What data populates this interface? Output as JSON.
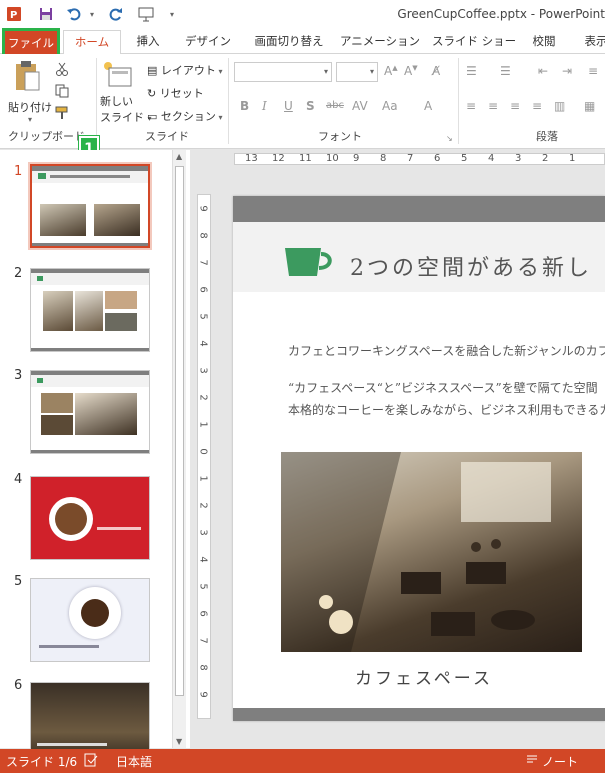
{
  "titlebar": {
    "app_icon": "powerpoint-icon",
    "title": "GreenCupCoffee.pptx - PowerPoint"
  },
  "tabs": [
    {
      "label": "ファイル"
    },
    {
      "label": "ホーム"
    },
    {
      "label": "挿入"
    },
    {
      "label": "デザイン"
    },
    {
      "label": "画面切り替え"
    },
    {
      "label": "アニメーション"
    },
    {
      "label": "スライド ショー"
    },
    {
      "label": "校閲"
    },
    {
      "label": "表示"
    }
  ],
  "ribbon": {
    "clipboard": {
      "paste": "貼り付け",
      "group": "クリップボード"
    },
    "slides": {
      "new_slide_line1": "新しい",
      "new_slide_line2": "スライド",
      "layout": "レイアウト",
      "reset": "リセット",
      "section": "セクション",
      "group": "スライド"
    },
    "font": {
      "group": "フォント"
    },
    "paragraph": {
      "group": "段落"
    }
  },
  "callout": {
    "badge": "1"
  },
  "thumbnails": [
    {
      "number": "1",
      "selected": true
    },
    {
      "number": "2",
      "selected": false
    },
    {
      "number": "3",
      "selected": false
    },
    {
      "number": "4",
      "selected": false
    },
    {
      "number": "5",
      "selected": false
    },
    {
      "number": "6",
      "selected": false
    }
  ],
  "ruler": {
    "h_ticks": [
      "13",
      "12",
      "11",
      "10",
      "9",
      "8",
      "7",
      "6",
      "5",
      "4",
      "3",
      "2",
      "1"
    ],
    "v_ticks": [
      "9",
      "8",
      "7",
      "6",
      "5",
      "4",
      "3",
      "2",
      "1",
      "0",
      "1",
      "2",
      "3",
      "4",
      "5",
      "6",
      "7",
      "8",
      "9"
    ]
  },
  "slide": {
    "title": "2つの空間がある新し",
    "line1": "カフェとコワーキングスペースを融合した新ジャンルのカフ",
    "line2": "“カフェスペース“と”ビジネススペース”を壁で隔てた空間",
    "line3": "本格的なコーヒーを楽しみながら、ビジネス利用もできるカ",
    "caption": "カフェスペース",
    "accent": "#3c9a5f"
  },
  "statusbar": {
    "slide_info": "スライド 1/6",
    "language": "日本語",
    "notes": "ノート"
  },
  "colors": {
    "brand": "#d24726",
    "highlight": "#2ab34a"
  }
}
